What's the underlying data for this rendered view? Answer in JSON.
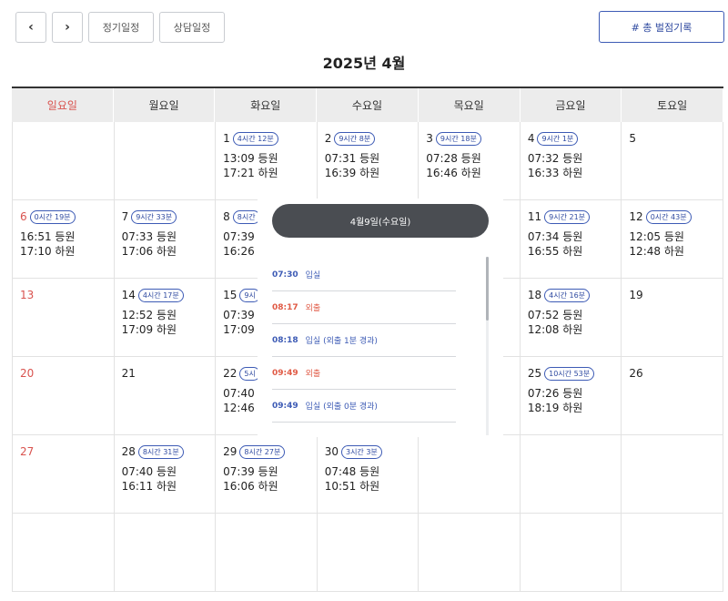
{
  "toolbar": {
    "prev_icon": "‹",
    "next_icon": "›",
    "regular_label": "정기일정",
    "consult_label": "상담일정",
    "record_label": "# 총 벌점기록"
  },
  "month_title": "2025년 4월",
  "weekdays": [
    "일요일",
    "월요일",
    "화요일",
    "수요일",
    "목요일",
    "금요일",
    "토요일"
  ],
  "weeks": [
    [
      {
        "day": "",
        "hours": "",
        "in": "",
        "out": ""
      },
      {
        "day": "",
        "hours": "",
        "in": "",
        "out": ""
      },
      {
        "day": "1",
        "hours": "4시간 12분",
        "in": "13:09 등원",
        "out": "17:21 하원"
      },
      {
        "day": "2",
        "hours": "9시간 8분",
        "in": "07:31 등원",
        "out": "16:39 하원"
      },
      {
        "day": "3",
        "hours": "9시간 18분",
        "in": "07:28 등원",
        "out": "16:46 하원"
      },
      {
        "day": "4",
        "hours": "9시간 1분",
        "in": "07:32 등원",
        "out": "16:33 하원"
      },
      {
        "day": "5",
        "hours": "",
        "in": "",
        "out": ""
      }
    ],
    [
      {
        "day": "6",
        "hours": "0시간 19분",
        "in": "16:51 등원",
        "out": "17:10 하원"
      },
      {
        "day": "7",
        "hours": "9시간 33분",
        "in": "07:33 등원",
        "out": "17:06 하원"
      },
      {
        "day": "8",
        "hours": "8시간",
        "in": "07:39 등",
        "out": "16:26 하"
      },
      {
        "day": "",
        "hours": "",
        "in": "",
        "out": ""
      },
      {
        "day": "",
        "hours": "",
        "in": "",
        "out": ""
      },
      {
        "day": "11",
        "hours": "9시간 21분",
        "in": "07:34 등원",
        "out": "16:55 하원"
      },
      {
        "day": "12",
        "hours": "0시간 43분",
        "in": "12:05 등원",
        "out": "12:48 하원"
      }
    ],
    [
      {
        "day": "13",
        "hours": "",
        "in": "",
        "out": ""
      },
      {
        "day": "14",
        "hours": "4시간 17분",
        "in": "12:52 등원",
        "out": "17:09 하원"
      },
      {
        "day": "15",
        "hours": "9시",
        "in": "07:39 등",
        "out": "17:09 하"
      },
      {
        "day": "",
        "hours": "",
        "in": "",
        "out": ""
      },
      {
        "day": "",
        "hours": "",
        "in": "",
        "out": ""
      },
      {
        "day": "18",
        "hours": "4시간 16분",
        "in": "07:52 등원",
        "out": "12:08 하원"
      },
      {
        "day": "19",
        "hours": "",
        "in": "",
        "out": ""
      }
    ],
    [
      {
        "day": "20",
        "hours": "",
        "in": "",
        "out": ""
      },
      {
        "day": "21",
        "hours": "",
        "in": "",
        "out": ""
      },
      {
        "day": "22",
        "hours": "5시",
        "in": "07:40 등",
        "out": "12:46 하"
      },
      {
        "day": "",
        "hours": "",
        "in": "",
        "out": ""
      },
      {
        "day": "",
        "hours": "",
        "in": "",
        "out": ""
      },
      {
        "day": "25",
        "hours": "10시간 53분",
        "in": "07:26 등원",
        "out": "18:19 하원"
      },
      {
        "day": "26",
        "hours": "",
        "in": "",
        "out": ""
      }
    ],
    [
      {
        "day": "27",
        "hours": "",
        "in": "",
        "out": ""
      },
      {
        "day": "28",
        "hours": "8시간 31분",
        "in": "07:40 등원",
        "out": "16:11 하원"
      },
      {
        "day": "29",
        "hours": "8시간 27분",
        "in": "07:39 등원",
        "out": "16:06 하원"
      },
      {
        "day": "30",
        "hours": "3시간 3분",
        "in": "07:48 등원",
        "out": "10:51 하원"
      },
      {
        "day": "",
        "hours": "",
        "in": "",
        "out": ""
      },
      {
        "day": "",
        "hours": "",
        "in": "",
        "out": ""
      },
      {
        "day": "",
        "hours": "",
        "in": "",
        "out": ""
      }
    ],
    [
      {
        "day": "",
        "hours": "",
        "in": "",
        "out": ""
      },
      {
        "day": "",
        "hours": "",
        "in": "",
        "out": ""
      },
      {
        "day": "",
        "hours": "",
        "in": "",
        "out": ""
      },
      {
        "day": "",
        "hours": "",
        "in": "",
        "out": ""
      },
      {
        "day": "",
        "hours": "",
        "in": "",
        "out": ""
      },
      {
        "day": "",
        "hours": "",
        "in": "",
        "out": ""
      },
      {
        "day": "",
        "hours": "",
        "in": "",
        "out": ""
      }
    ]
  ],
  "popup": {
    "title": "4월9일(수요일)",
    "entries": [
      {
        "time": "07:30",
        "label": "입실",
        "type": "in"
      },
      {
        "time": "08:17",
        "label": "외출",
        "type": "out"
      },
      {
        "time": "08:18",
        "label": "입실 (외출 1분 경과)",
        "type": "in"
      },
      {
        "time": "09:49",
        "label": "외출",
        "type": "out"
      },
      {
        "time": "09:49",
        "label": "입실 (외출 0분 경과)",
        "type": "in"
      }
    ]
  },
  "colors": {
    "accent": "#3d5bb5",
    "sunday": "#d9534f",
    "out_event": "#e05a45",
    "popup_header": "#4a4d52"
  }
}
